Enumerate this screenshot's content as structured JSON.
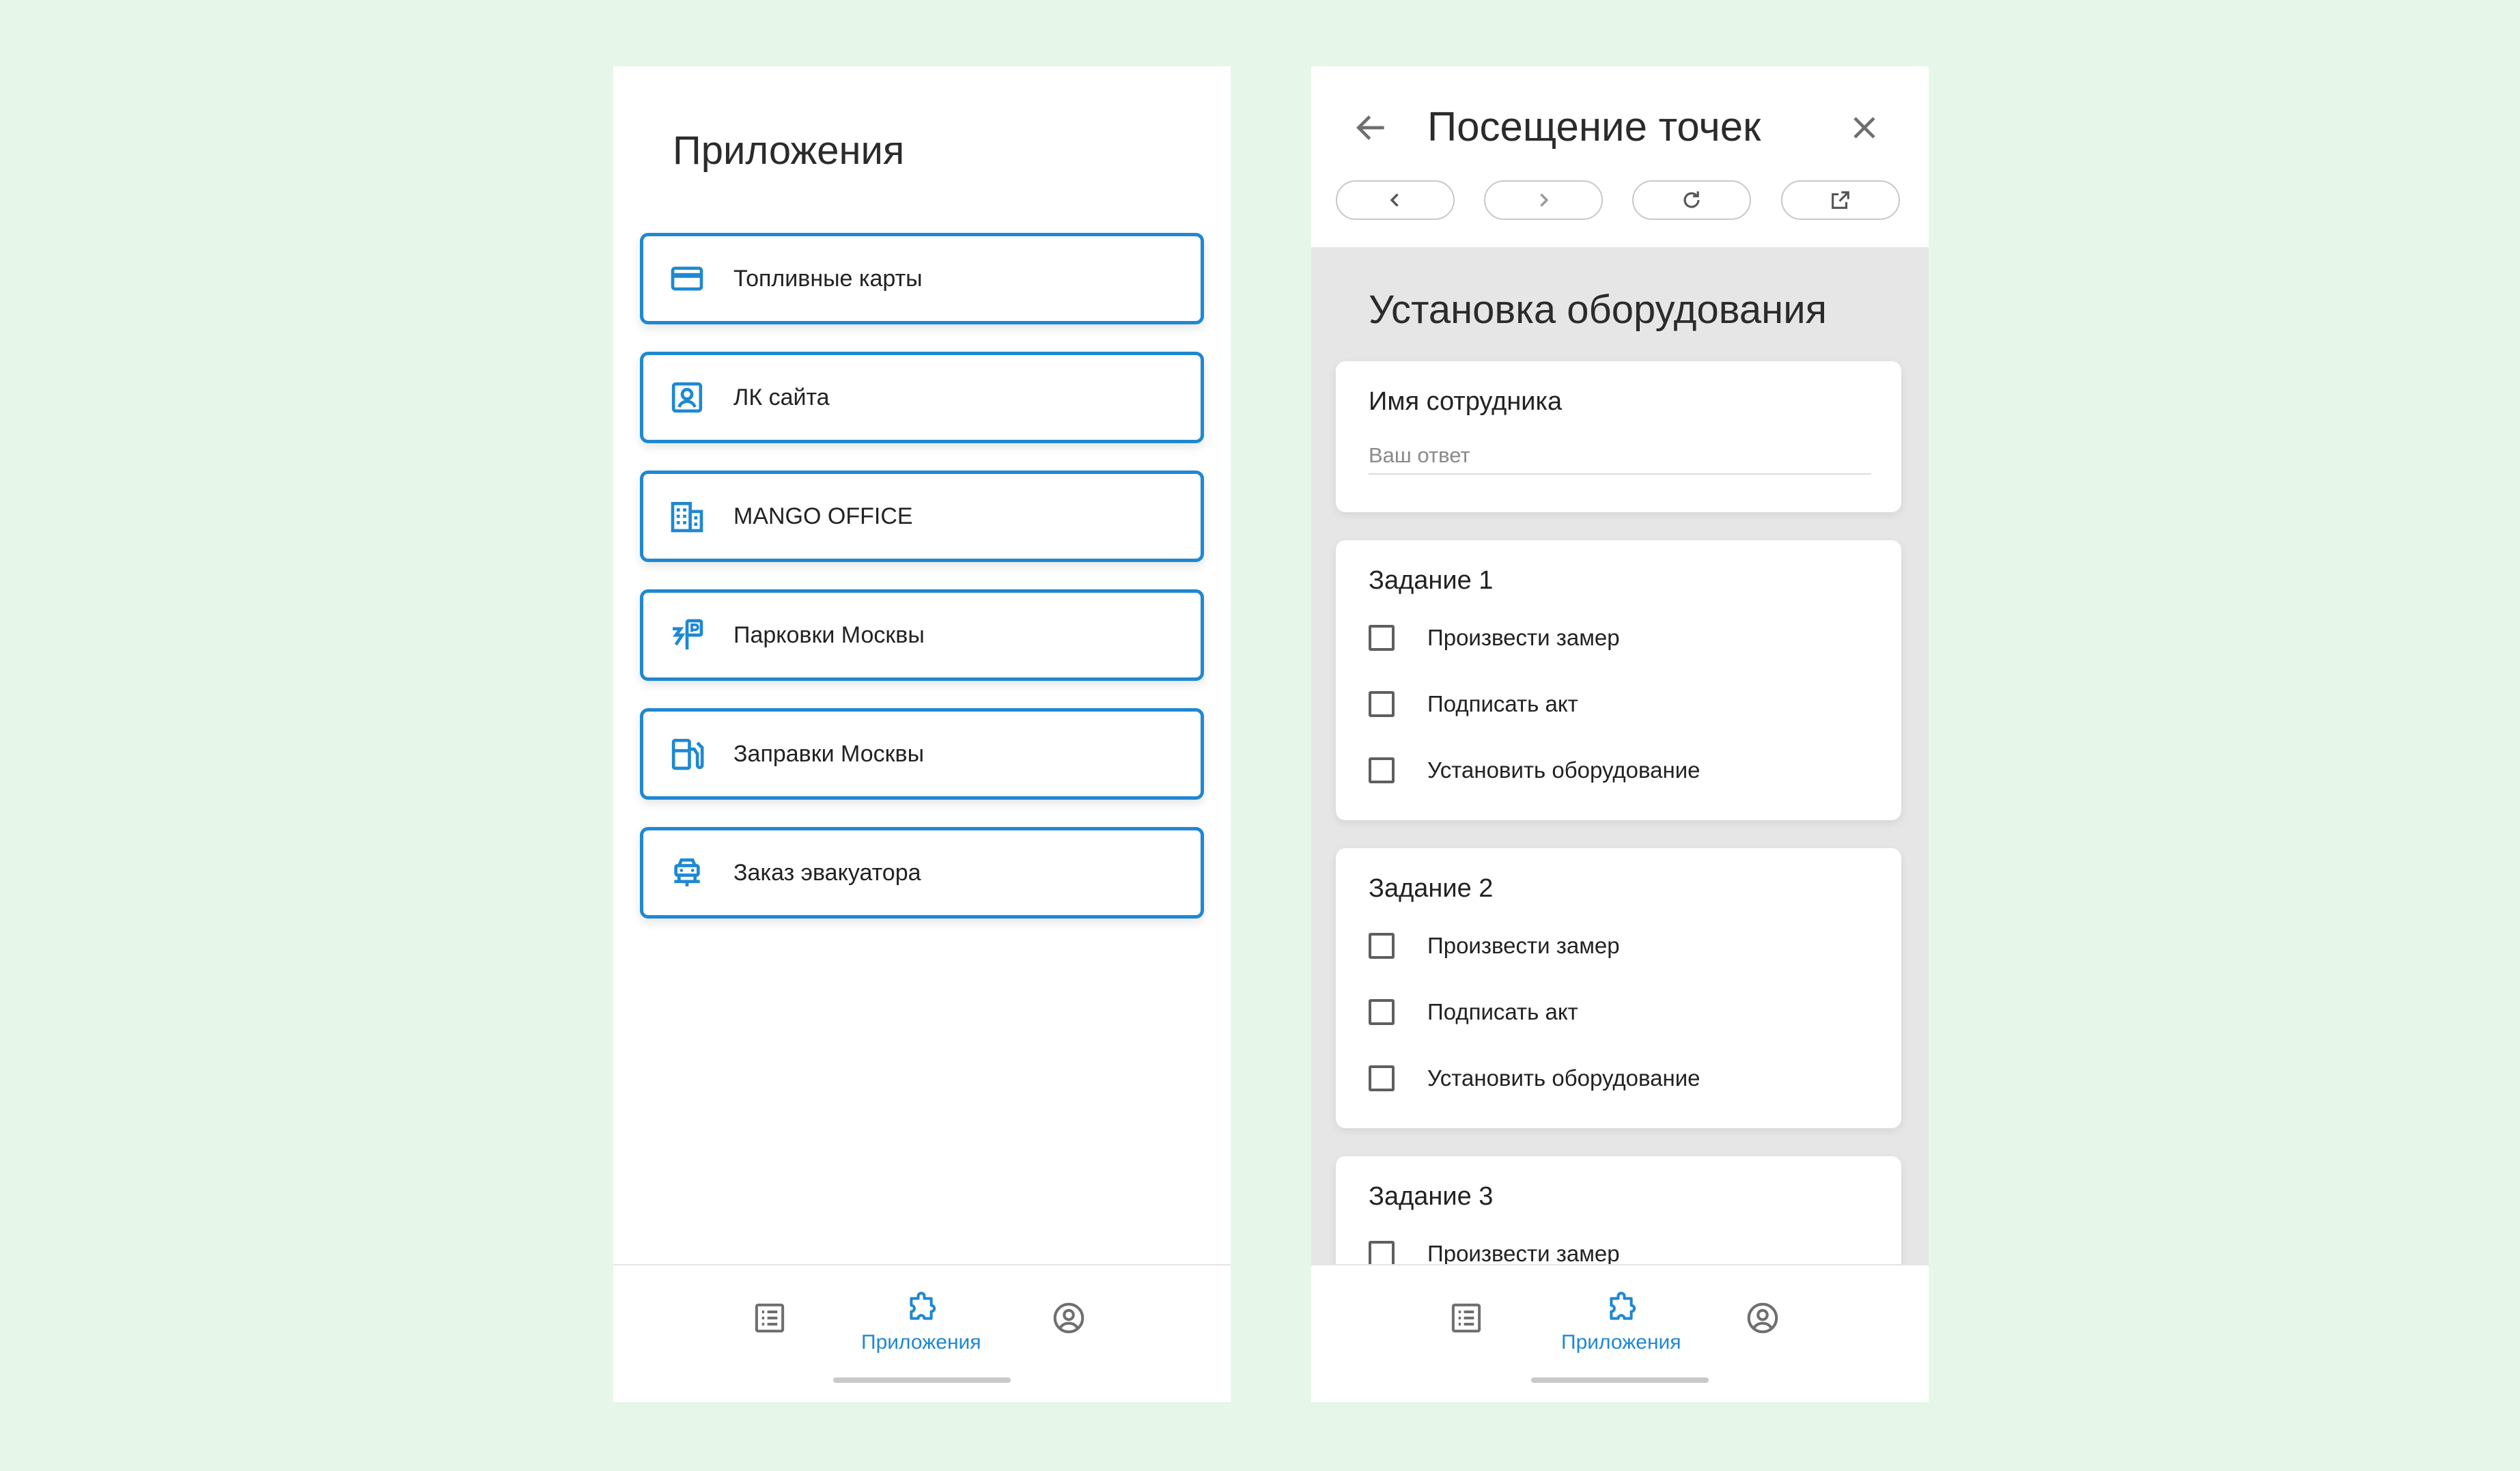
{
  "apps_screen": {
    "title": "Приложения",
    "items": [
      {
        "label": "Топливные карты",
        "icon": "credit-card-icon"
      },
      {
        "label": "ЛК сайта",
        "icon": "account-box-icon"
      },
      {
        "label": "MANGO OFFICE",
        "icon": "building-icon"
      },
      {
        "label": "Парковки Москвы",
        "icon": "parking-icon"
      },
      {
        "label": "Заправки Москвы",
        "icon": "fuel-station-icon"
      },
      {
        "label": "Заказ эвакуатора",
        "icon": "tow-truck-icon"
      }
    ]
  },
  "form_screen": {
    "title": "Посещение точек",
    "browser_controls": [
      "back-icon",
      "forward-icon",
      "reload-icon",
      "open-external-icon"
    ],
    "form_title": "Установка оборудования",
    "employee": {
      "label": "Имя сотрудника",
      "placeholder": "Ваш ответ"
    },
    "tasks": [
      {
        "title": "Задание 1",
        "options": [
          "Произвести замер",
          "Подписать акт",
          "Установить оборудование"
        ]
      },
      {
        "title": "Задание 2",
        "options": [
          "Произвести замер",
          "Подписать акт",
          "Установить оборудование"
        ]
      },
      {
        "title": "Задание 3",
        "options": [
          "Произвести замер"
        ]
      }
    ]
  },
  "bottom_nav": {
    "items": [
      {
        "icon": "list-icon",
        "label": ""
      },
      {
        "icon": "puzzle-icon",
        "label": "Приложения",
        "active": true
      },
      {
        "icon": "profile-icon",
        "label": ""
      }
    ]
  },
  "colors": {
    "accent": "#1e88d2",
    "background": "#e6f7ea",
    "form_background": "#e6e6e6"
  }
}
